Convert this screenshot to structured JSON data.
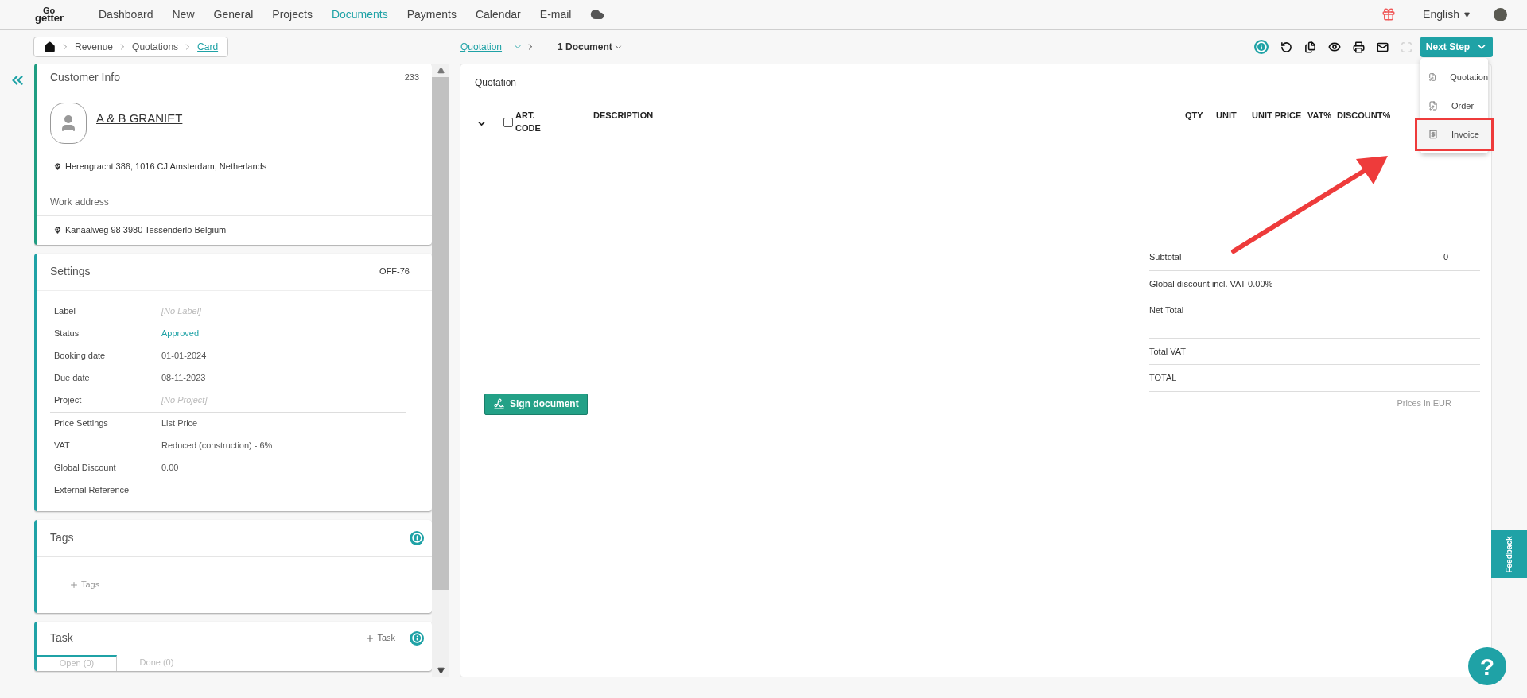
{
  "logo": {
    "top": "Go",
    "bottom": "getter"
  },
  "nav": {
    "items": [
      {
        "label": "Dashboard",
        "selected": false
      },
      {
        "label": "New",
        "selected": false
      },
      {
        "label": "General",
        "selected": false
      },
      {
        "label": "Projects",
        "selected": false
      },
      {
        "label": "Documents",
        "selected": true
      },
      {
        "label": "Payments",
        "selected": false
      },
      {
        "label": "Calendar",
        "selected": false
      },
      {
        "label": "E-mail",
        "selected": false
      }
    ],
    "language": "English"
  },
  "breadcrumb": [
    {
      "label": "Revenue",
      "selected": false
    },
    {
      "label": "Quotations",
      "selected": false
    },
    {
      "label": "Card",
      "selected": true
    }
  ],
  "doc_nav": {
    "type_link": "Quotation",
    "count": "1 Document"
  },
  "toolbar": [
    {
      "kind": "info",
      "disabled": false
    },
    {
      "kind": "undo",
      "disabled": false
    },
    {
      "kind": "copy",
      "disabled": false
    },
    {
      "kind": "preview",
      "disabled": false
    },
    {
      "kind": "print",
      "disabled": false
    },
    {
      "kind": "mail",
      "disabled": false
    },
    {
      "kind": "frame",
      "disabled": true
    }
  ],
  "next_step": {
    "label": "Next Step",
    "menu": [
      {
        "label": "Quotation",
        "kind": "edit",
        "highlighted": false
      },
      {
        "label": "Order",
        "kind": "edit",
        "highlighted": false
      },
      {
        "label": "Invoice",
        "kind": "invoice",
        "highlighted": true
      }
    ]
  },
  "customer": {
    "title": "Customer Info",
    "number": "233",
    "name": "A & B GRANIET",
    "address": "Herengracht 386, 1016 CJ Amsterdam, Netherlands",
    "work_address_label": "Work address",
    "work_address": "Kanaalweg 98 3980 Tessenderlo Belgium"
  },
  "settings": {
    "title": "Settings",
    "code": "OFF-76",
    "groups": [
      [
        {
          "label": "Label",
          "value": "[No Label]",
          "kind": "placeholder"
        },
        {
          "label": "Status",
          "value": "Approved",
          "kind": "status"
        },
        {
          "label": "Booking date",
          "value": "01-01-2024",
          "kind": "plain"
        },
        {
          "label": "Due date",
          "value": "08-11-2023",
          "kind": "plain"
        },
        {
          "label": "Project",
          "value": "[No Project]",
          "kind": "placeholder"
        }
      ],
      [
        {
          "label": "Price Settings",
          "value": "List Price",
          "kind": "plain"
        },
        {
          "label": "VAT",
          "value": "Reduced (construction) - 6%",
          "kind": "plain"
        },
        {
          "label": "Global Discount",
          "value": "0.00",
          "kind": "plain"
        },
        {
          "label": "External Reference",
          "kind": "empty"
        }
      ]
    ]
  },
  "tags": {
    "title": "Tags",
    "add_label": "Tags"
  },
  "task": {
    "title": "Task",
    "add_label": "Task",
    "tabs": [
      {
        "label": "Open (0)",
        "selected": true
      },
      {
        "label": "Done (0)",
        "selected": false
      }
    ]
  },
  "document": {
    "title": "Quotation",
    "columns": [
      "ART. CODE",
      "DESCRIPTION",
      "QTY",
      "UNIT",
      "UNIT PRICE",
      "VAT%",
      "DISCOUNT%"
    ],
    "row_checked": false,
    "totals": [
      {
        "kind": "line",
        "label": "Subtotal",
        "value": "0"
      },
      {
        "kind": "line",
        "label": "Global discount incl. VAT 0.00%"
      },
      {
        "kind": "line",
        "label": "Net Total"
      },
      {
        "kind": "blank"
      },
      {
        "kind": "line",
        "label": "Total VAT"
      },
      {
        "kind": "line",
        "label": "TOTAL"
      }
    ],
    "note": "Prices in EUR",
    "sign_button": "Sign document"
  },
  "feedback": "Feedback",
  "help": "?"
}
